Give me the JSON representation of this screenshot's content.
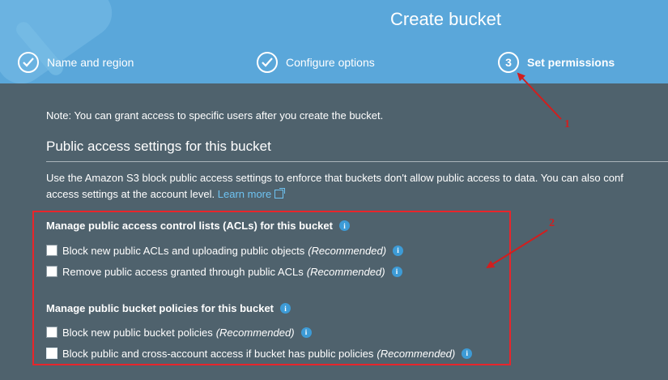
{
  "header": {
    "title": "Create bucket",
    "steps": [
      {
        "label": "Name and region",
        "state": "done",
        "icon": "check-icon"
      },
      {
        "label": "Configure options",
        "state": "done",
        "icon": "check-icon"
      },
      {
        "label": "Set permissions",
        "state": "active",
        "number": "3"
      }
    ]
  },
  "main": {
    "note": "Note: You can grant access to specific users after you create the bucket.",
    "section_title": "Public access settings for this bucket",
    "description_line1": "Use the Amazon S3 block public access settings to enforce that buckets don't allow public access to data. You can also conf",
    "description_line2": "access settings at the account level.",
    "learn_more": "Learn more",
    "acl_group": {
      "title": "Manage public access control lists (ACLs) for this bucket",
      "options": [
        {
          "label": "Block new public ACLs and uploading public objects",
          "note": "(Recommended)",
          "checked": false
        },
        {
          "label": "Remove public access granted through public ACLs",
          "note": "(Recommended)",
          "checked": false
        }
      ]
    },
    "policy_group": {
      "title": "Manage public bucket policies for this bucket",
      "options": [
        {
          "label": "Block new public bucket policies",
          "note": "(Recommended)",
          "checked": false
        },
        {
          "label": "Block public and cross-account access if bucket has public policies",
          "note": "(Recommended)",
          "checked": false
        }
      ]
    }
  },
  "annotations": {
    "label1": "1",
    "label2": "2",
    "color": "#d21e1e"
  },
  "colors": {
    "header_bg": "#5aa7da",
    "body_bg": "#4f626d",
    "link": "#6ec3f2",
    "info_icon": "#3d9bd6",
    "highlight_box": "#e8252b"
  }
}
